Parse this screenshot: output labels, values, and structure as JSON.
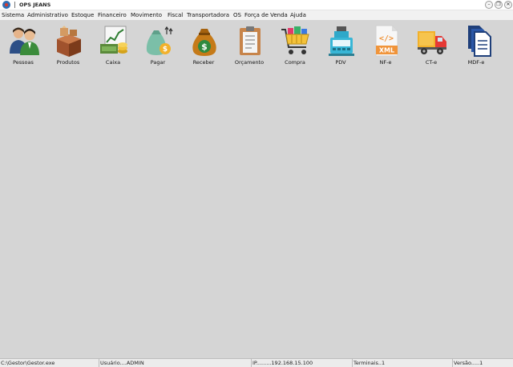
{
  "window": {
    "separator": "|",
    "title": "OPS JEANS",
    "minimize_glyph": "–",
    "restore_glyph": "❐",
    "close_glyph": "✕"
  },
  "menu": [
    {
      "label": "Sistema"
    },
    {
      "label": "Administrativo"
    },
    {
      "label": "Estoque"
    },
    {
      "label": "Financeiro"
    },
    {
      "label": "Movimento"
    },
    {
      "label": "Fiscal"
    },
    {
      "label": "Transportadora"
    },
    {
      "label": "OS"
    },
    {
      "label": "Força de Venda"
    },
    {
      "label": "Ajuda"
    }
  ],
  "toolbar": [
    {
      "label": "Pessoas",
      "icon": "people-icon"
    },
    {
      "label": "Produtos",
      "icon": "boxes-icon"
    },
    {
      "label": "Caixa",
      "icon": "cash-register-icon"
    },
    {
      "label": "Pagar",
      "icon": "money-bag-pay-icon"
    },
    {
      "label": "Receber",
      "icon": "money-bag-receive-icon"
    },
    {
      "label": "Orçamento",
      "icon": "clipboard-icon"
    },
    {
      "label": "Compra",
      "icon": "shopping-cart-icon"
    },
    {
      "label": "PDV",
      "icon": "pos-terminal-icon"
    },
    {
      "label": "NF-e",
      "icon": "xml-file-icon",
      "icon_text": "XML",
      "icon_code": "</>"
    },
    {
      "label": "CT-e",
      "icon": "delivery-truck-icon"
    },
    {
      "label": "MDF-e",
      "icon": "documents-icon"
    }
  ],
  "status": {
    "path": "C:\\Gestor\\Gestor.exe",
    "user": "Usuário....ADMIN",
    "ip": "IP.........192.168.15.100",
    "terminals": "Terminais..1",
    "version": "Versão.....1"
  },
  "colors": {
    "workspace": "#d5d5d5",
    "menubar": "#f1f1f1",
    "statusbar": "#ececec"
  }
}
